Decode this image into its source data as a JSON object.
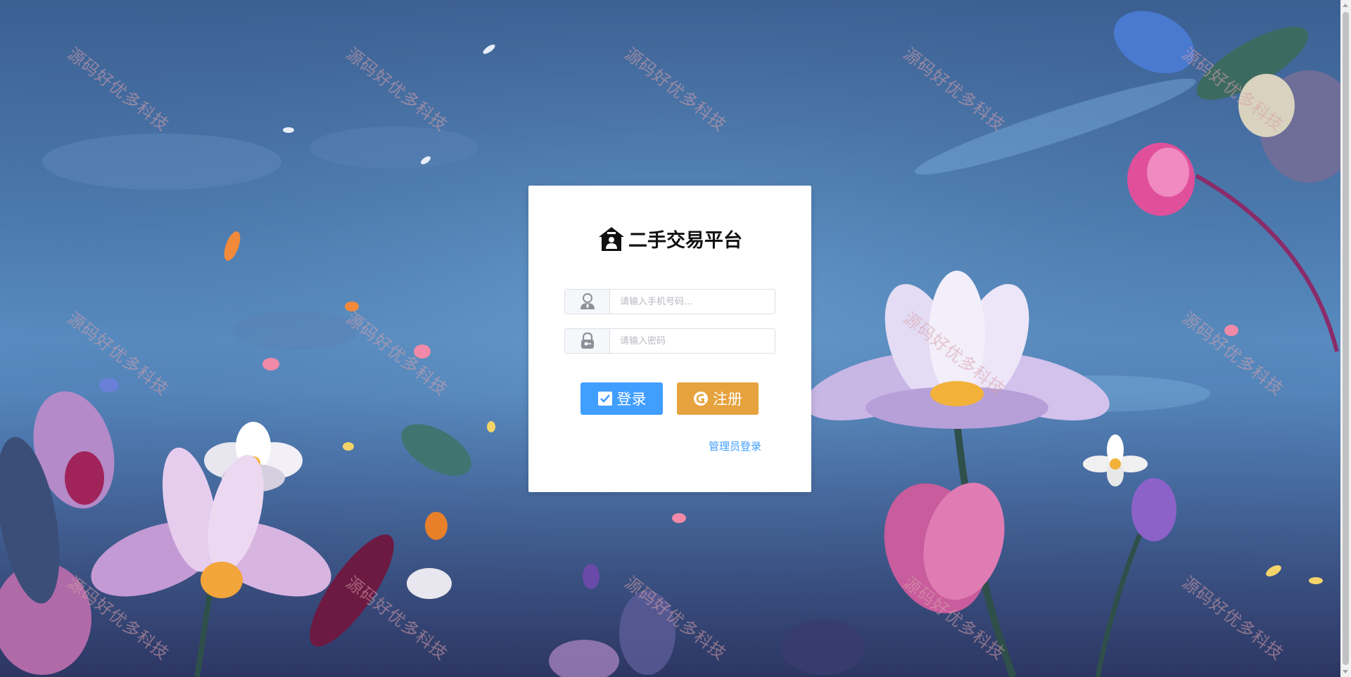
{
  "app": {
    "title": "二手交易平台",
    "logo_icon": "house-icon"
  },
  "login": {
    "phone_placeholder": "请输入手机号码...",
    "phone_value": "",
    "password_placeholder": "请输入密码",
    "password_value": "",
    "login_label": "登录",
    "register_label": "注册",
    "admin_login_label": "管理员登录"
  },
  "icons": {
    "phone_prefix": "user-icon",
    "password_prefix": "lock-icon",
    "login": "checkbox-icon",
    "register": "register-icon"
  },
  "colors": {
    "primary": "#409eff",
    "warning": "#e6a23c",
    "background": "#4b79ad"
  },
  "watermark": "源码好优多科技"
}
